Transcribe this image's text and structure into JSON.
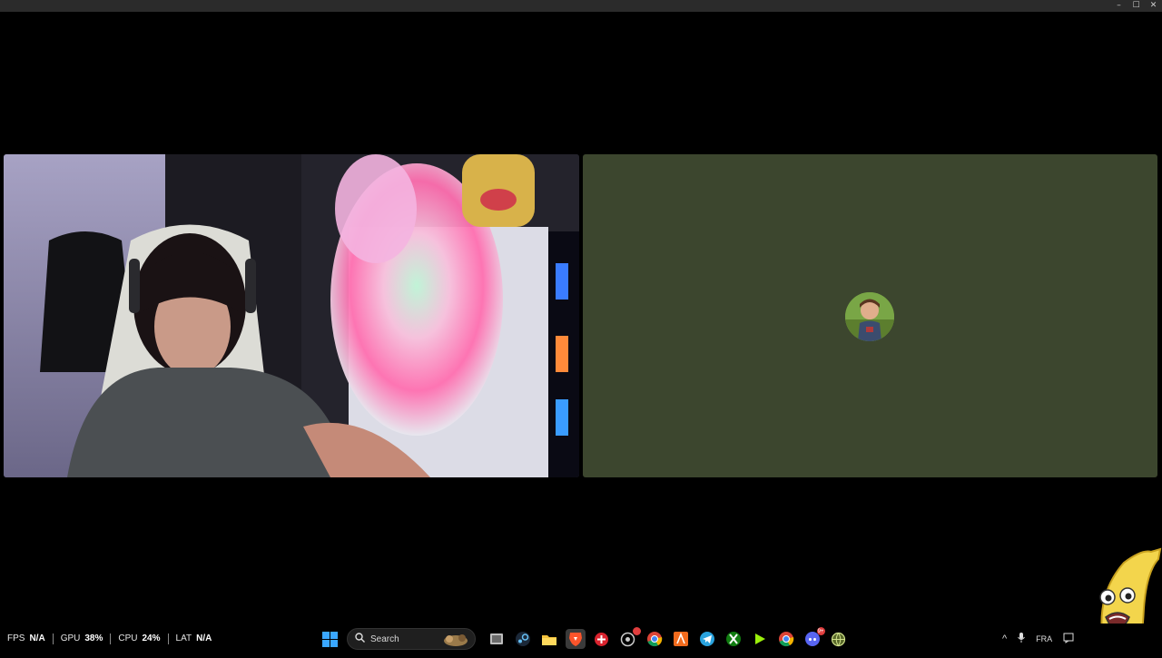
{
  "window_controls": {
    "minimize_icon": "–",
    "maximize_icon": "☐",
    "close_icon": "✕"
  },
  "stats": [
    {
      "label": "FPS",
      "value": "N/A"
    },
    {
      "label": "GPU",
      "value": "38%"
    },
    {
      "label": "CPU",
      "value": "24%"
    },
    {
      "label": "LAT",
      "value": "N/A"
    }
  ],
  "taskbar": {
    "search_label": "Search",
    "apps": [
      "start-icon",
      "search",
      "task-view-icon",
      "steam-icon",
      "file-explorer-icon",
      "brave-icon",
      "app-red-icon",
      "app-settings-icon",
      "chrome-icon",
      "app-orange-icon",
      "telegram-icon",
      "xbox-icon",
      "game-pass-icon",
      "chrome-icon-2",
      "discord-icon",
      "app-globe-icon"
    ],
    "discord_badge": "9+"
  },
  "tray": {
    "language": "FRA",
    "show_hidden_icon": "^"
  },
  "colors": {
    "avatar_tile_bg": "#3c462e",
    "titlebar": "#2b2b2b"
  }
}
